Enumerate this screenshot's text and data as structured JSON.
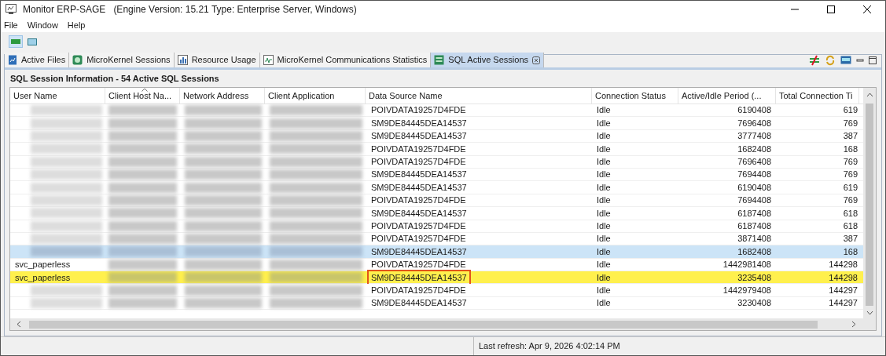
{
  "window": {
    "title": "Monitor ERP-SAGE",
    "subtitle": "(Engine Version: 15.21  Type: Enterprise Server, Windows)"
  },
  "menu": [
    "File",
    "Window",
    "Help"
  ],
  "tabs": [
    {
      "label": "Active Files",
      "selected": false
    },
    {
      "label": "MicroKernel Sessions",
      "selected": false
    },
    {
      "label": "Resource Usage",
      "selected": false
    },
    {
      "label": "MicroKernel Communications Statistics",
      "selected": false
    },
    {
      "label": "SQL Active Sessions",
      "selected": true
    }
  ],
  "panel": {
    "title": "SQL Session Information - 54 Active SQL Sessions"
  },
  "table": {
    "columns": [
      "User Name",
      "Client Host Na...",
      "Network Address",
      "Client Application",
      "Data Source Name",
      "Connection Status",
      "Active/Idle Period (...",
      "Total Connection Ti"
    ],
    "rows": [
      {
        "data_source": "POIVDATA19257D4FDE",
        "status": "Idle",
        "active_idle": "6190408",
        "total": "619",
        "selected": false,
        "highlighted": false,
        "data_source_outlined": false
      },
      {
        "data_source": "SM9DE84445DEA14537",
        "status": "Idle",
        "active_idle": "7696408",
        "total": "769",
        "selected": false,
        "highlighted": false,
        "data_source_outlined": false
      },
      {
        "data_source": "SM9DE84445DEA14537",
        "status": "Idle",
        "active_idle": "3777408",
        "total": "387",
        "selected": false,
        "highlighted": false,
        "data_source_outlined": false
      },
      {
        "data_source": "POIVDATA19257D4FDE",
        "status": "Idle",
        "active_idle": "1682408",
        "total": "168",
        "selected": false,
        "highlighted": false,
        "data_source_outlined": false
      },
      {
        "data_source": "POIVDATA19257D4FDE",
        "status": "Idle",
        "active_idle": "7696408",
        "total": "769",
        "selected": false,
        "highlighted": false,
        "data_source_outlined": false
      },
      {
        "data_source": "SM9DE84445DEA14537",
        "status": "Idle",
        "active_idle": "7694408",
        "total": "769",
        "selected": false,
        "highlighted": false,
        "data_source_outlined": false
      },
      {
        "data_source": "SM9DE84445DEA14537",
        "status": "Idle",
        "active_idle": "6190408",
        "total": "619",
        "selected": false,
        "highlighted": false,
        "data_source_outlined": false
      },
      {
        "data_source": "POIVDATA19257D4FDE",
        "status": "Idle",
        "active_idle": "7694408",
        "total": "769",
        "selected": false,
        "highlighted": false,
        "data_source_outlined": false
      },
      {
        "data_source": "SM9DE84445DEA14537",
        "status": "Idle",
        "active_idle": "6187408",
        "total": "618",
        "selected": false,
        "highlighted": false,
        "data_source_outlined": false
      },
      {
        "data_source": "POIVDATA19257D4FDE",
        "status": "Idle",
        "active_idle": "6187408",
        "total": "618",
        "selected": false,
        "highlighted": false,
        "data_source_outlined": false
      },
      {
        "data_source": "POIVDATA19257D4FDE",
        "status": "Idle",
        "active_idle": "3871408",
        "total": "387",
        "selected": false,
        "highlighted": false,
        "data_source_outlined": false
      },
      {
        "data_source": "SM9DE84445DEA14537",
        "status": "Idle",
        "active_idle": "1682408",
        "total": "168",
        "selected": true,
        "highlighted": false,
        "data_source_outlined": false
      },
      {
        "user_name": "svc_paperless",
        "data_source": "POIVDATA19257D4FDE",
        "status": "Idle",
        "active_idle": "1442981408",
        "total": "144298",
        "selected": false,
        "highlighted": false,
        "data_source_outlined": false
      },
      {
        "user_name": "svc_paperless",
        "data_source": "SM9DE84445DEA14537",
        "data_source_outlined": true,
        "status": "Idle",
        "active_idle": "3235408",
        "total": "144298",
        "selected": false,
        "highlighted": true
      },
      {
        "data_source": "POIVDATA19257D4FDE",
        "status": "Idle",
        "active_idle": "1442979408",
        "total": "144297",
        "selected": false,
        "highlighted": false,
        "data_source_outlined": false
      },
      {
        "data_source": "SM9DE84445DEA14537",
        "status": "Idle",
        "active_idle": "3230408",
        "total": "144297",
        "selected": false,
        "highlighted": false,
        "data_source_outlined": false
      }
    ]
  },
  "status_bar": {
    "text": "Last refresh: Apr 9, 2026 4:02:14 PM"
  }
}
